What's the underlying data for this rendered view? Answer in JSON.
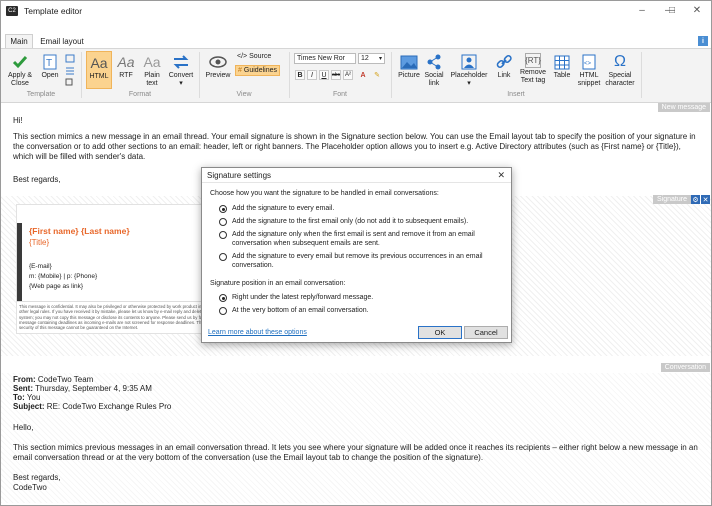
{
  "window": {
    "title": "Template editor",
    "icon": "C2"
  },
  "tabs": [
    "Main",
    "Email layout"
  ],
  "ribbon": {
    "apply_close": "Apply & Close",
    "open": "Open",
    "html": "HTML",
    "rtf": "RTF",
    "plain": "Plain text",
    "convert": "Convert",
    "preview": "Preview",
    "source": "</> Source",
    "guidelines": "Guidelines",
    "font_name": "Times New Ror",
    "font_size": "12",
    "picture": "Picture",
    "social": "Social link",
    "placeholder": "Placeholder",
    "link": "Link",
    "remove_tag": "Remove Text tag",
    "table": "Table",
    "html_snippet": "HTML snippet",
    "special": "Special character",
    "groups": [
      "Template",
      "Format",
      "View",
      "Font",
      "Insert"
    ]
  },
  "labels": {
    "new_message": "New message",
    "signature": "Signature",
    "conversation": "Conversation"
  },
  "message": {
    "greeting": "Hi!",
    "body": "This section mimics a new message in an email thread. Your email signature is shown in the Signature section below. You can use the Email layout tab to specify the position of your signature in the conversation or to add other sections to an email: header, left or right banners. The Placeholder option allows you to insert e.g. Active Directory attributes (such as {First name} or {Title}), which will be filled with sender's data.",
    "regards": "Best regards,"
  },
  "signature": {
    "name": "{First name} {Last name}",
    "title": "{Title}",
    "email": "{E-mail}",
    "phones": "m: {Mobile} | p: {Phone}",
    "web": "{Web page as link}",
    "disclaimer": "This message is confidential. It may also be privileged or otherwise protected by work product immunity or other legal rules. If you have received it by mistake, please let us know by e-mail reply and delete it from your system; you may not copy this message or disclose its contents to anyone. Please send us by fax any message containing deadlines as incoming e-mails are not screened for response deadlines. The integrity and security of this message cannot be guaranteed on the Internet."
  },
  "dialog": {
    "title": "Signature settings",
    "question1": "Choose how you want the signature to be handled in email conversations:",
    "options1": [
      "Add the signature to every email.",
      "Add the signature to the first email only (do not add it to subsequent emails).",
      "Add the signature only when the first email is sent and remove it from an email conversation when subsequent emails are sent.",
      "Add the signature to every email but remove its previous occurrences in an email conversation."
    ],
    "question2": "Signature position in an email conversation:",
    "options2": [
      "Right under the latest reply/forward message.",
      "At the very bottom of an email conversation."
    ],
    "learn_more": "Learn more about these options",
    "ok": "OK",
    "cancel": "Cancel"
  },
  "conversation": {
    "from_label": "From:",
    "from": "CodeTwo Team",
    "sent_label": "Sent:",
    "sent": "Thursday, September 4, 9:35 AM",
    "to_label": "To:",
    "to": "You",
    "subject_label": "Subject:",
    "subject": "RE: CodeTwo Exchange Rules Pro",
    "hello": "Hello,",
    "body": "This section mimics previous messages in an email conversation thread. It lets you see where your signature will be added once it reaches its recipients – either right below a new message in an email conversation thread or at the very bottom of the conversation (use the Email layout tab to change the position of the signature).",
    "regards": "Best regards,",
    "company": "CodeTwo"
  },
  "colors": {
    "accent": "#e8672a",
    "link": "#1f6fbf",
    "selected": "#fbd38f"
  }
}
